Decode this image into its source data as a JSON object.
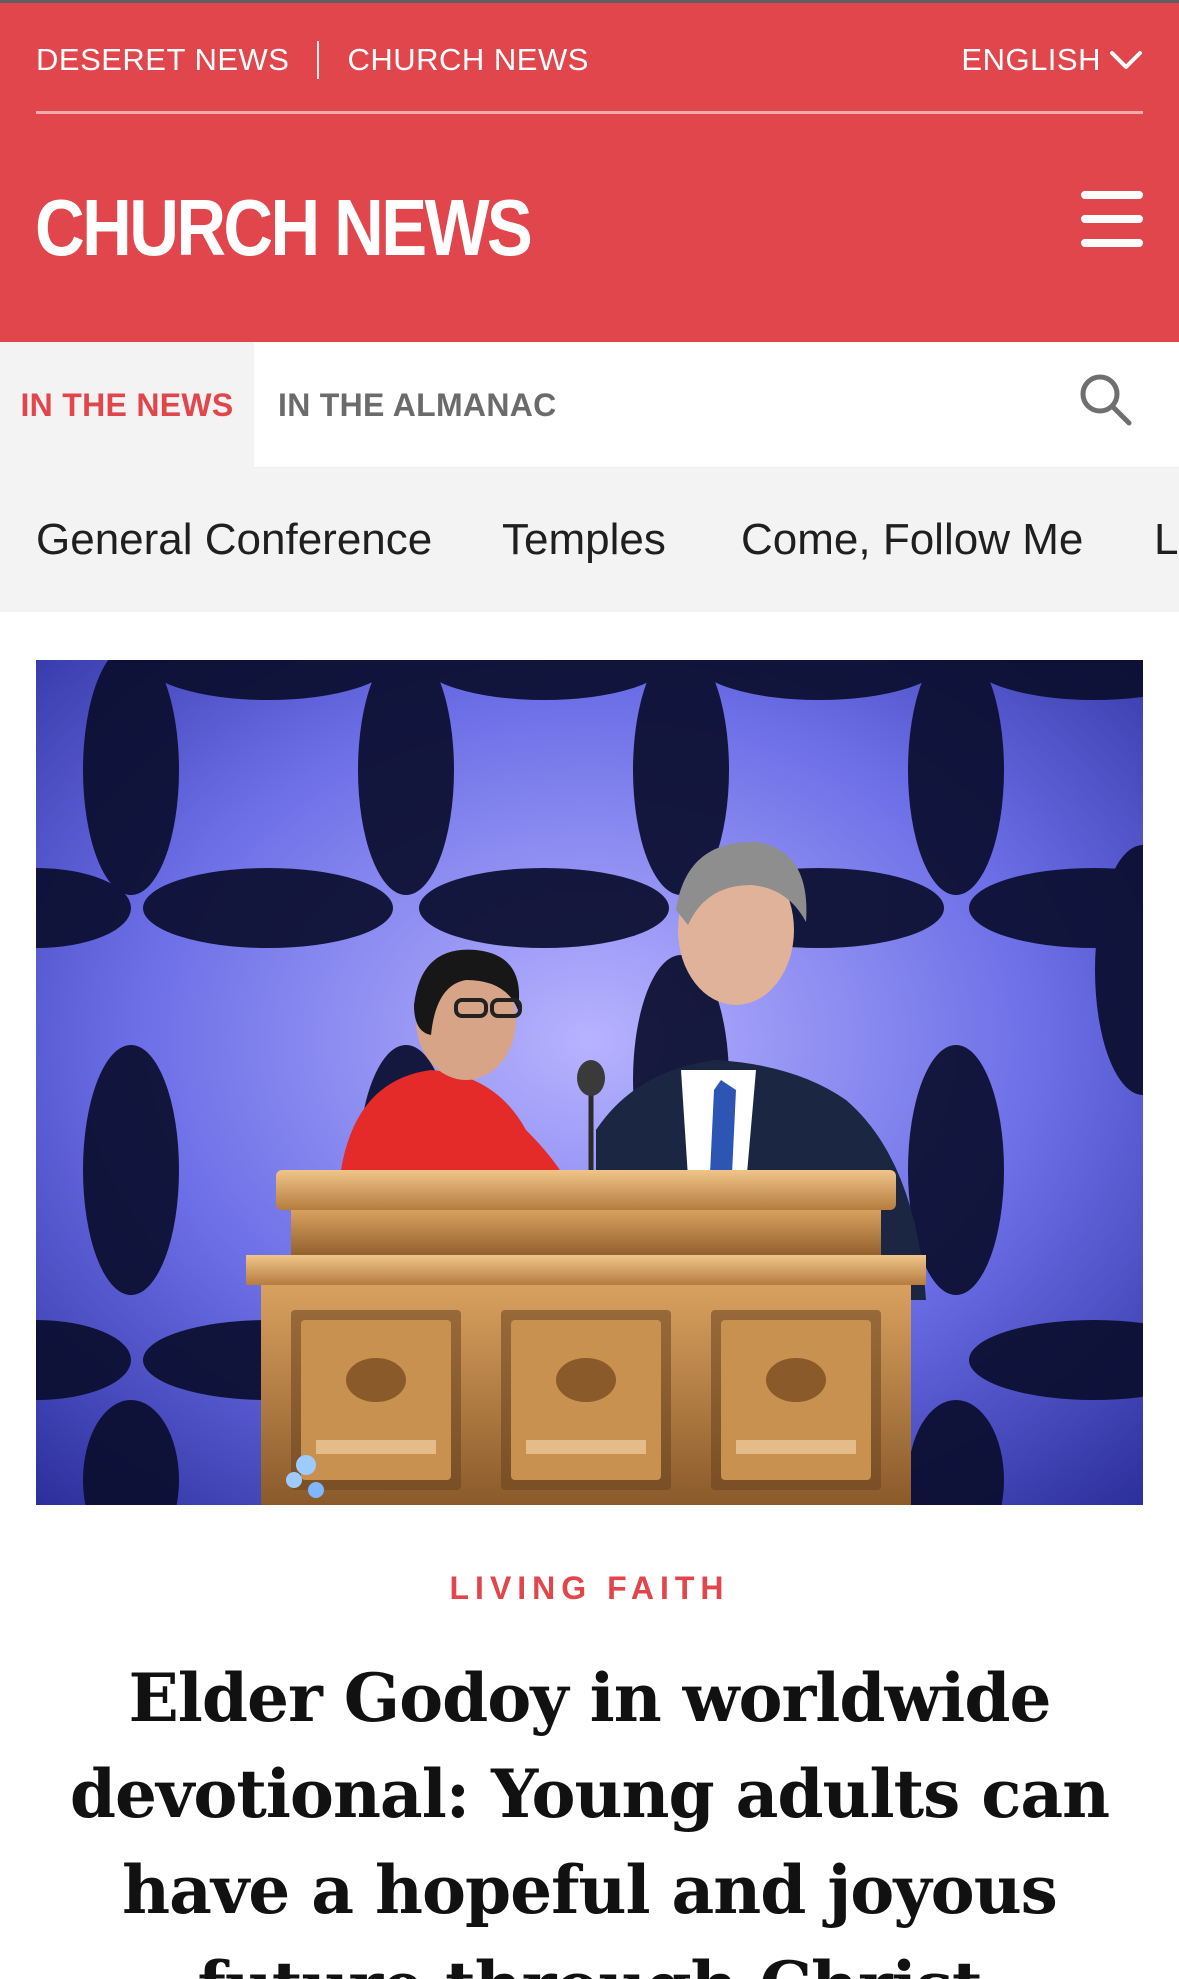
{
  "utility": {
    "link1": "DESERET NEWS",
    "link2": "CHURCH NEWS",
    "language": "ENGLISH"
  },
  "brand": {
    "title": "CHURCH NEWS"
  },
  "icons": {
    "menu": "hamburger-menu-icon",
    "search": "search-icon",
    "language": "chevron-down-icon"
  },
  "colors": {
    "brand_red": "#e0464b",
    "nav_bg": "#f3f3f3"
  },
  "sections": {
    "active": "IN THE NEWS",
    "other": "IN THE ALMANAC"
  },
  "topics": [
    "General Conference",
    "Temples",
    "Come, Follow Me",
    "L"
  ],
  "article": {
    "kicker": "LIVING FAITH",
    "headline": "Elder Godoy in worldwide devotional: Young adults can have a hopeful and joyous future through Christ"
  }
}
